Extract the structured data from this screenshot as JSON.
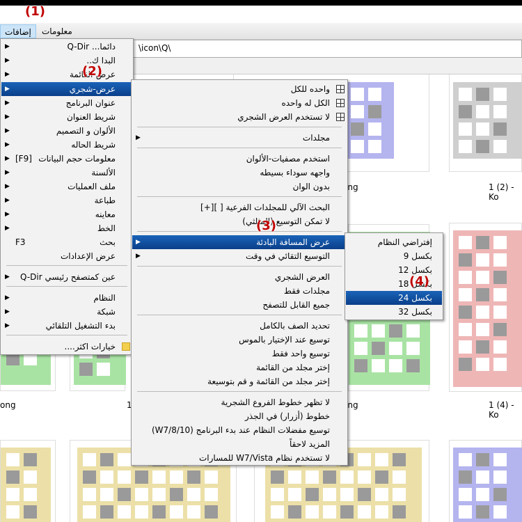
{
  "menubar": {
    "items": [
      "إضافات",
      "معلومات"
    ]
  },
  "address": {
    "path": "\\icon\\Q\\"
  },
  "captions": [
    "ong",
    "1 (2) - Ko",
    "ong",
    "1",
    "ong",
    "1 (4) - Ko"
  ],
  "callouts": [
    "(1)",
    "(2)",
    "(3)",
    "(4)"
  ],
  "menu_extras": {
    "items": [
      {
        "label": "دائما... Q-Dir",
        "sub": true
      },
      {
        "label": "البدا ك..",
        "sub": true
      },
      {
        "label": "عرض-القائمة",
        "sub": true
      },
      {
        "label": "عرض-شجري",
        "sub": true,
        "selected": true
      },
      {
        "label": "عنوان البرنامج",
        "sub": true
      },
      {
        "label": "شريط العنوان",
        "sub": true
      },
      {
        "label": "الألوان و التصميم",
        "sub": true
      },
      {
        "label": "شريط الحاله",
        "sub": true
      },
      {
        "label": "معلومات حجم البيانات",
        "shortcut": "[F9]",
        "sub": true
      },
      {
        "label": "الألسنة",
        "sub": true
      },
      {
        "label": "ملف العمليات",
        "sub": true
      },
      {
        "label": "طباعة",
        "sub": true
      },
      {
        "label": "معاينه",
        "sub": true
      },
      {
        "label": "الخط",
        "sub": true
      },
      {
        "label": "بحث",
        "shortcut": "F3"
      },
      {
        "label": "عرض الإعدادات"
      },
      {
        "label": "Q-Dir عين كمتصفح رئيسي",
        "sub": true
      },
      {
        "label": "النظام",
        "sub": true
      },
      {
        "label": "شبكة",
        "sub": true
      },
      {
        "label": "بدء التشغيل التلقائي",
        "sub": true
      },
      {
        "label": "خيارات اكثر...."
      }
    ]
  },
  "menu_tree": {
    "items": [
      {
        "label": "واحده للكل"
      },
      {
        "label": "الكل له واحده"
      },
      {
        "label": "لا تستخدم العرض الشجري"
      },
      {
        "label": "مجلدات",
        "sub": true
      },
      {
        "label": "استخدم مصفيات-الألوان"
      },
      {
        "label": "واجهه سوداء بسيطه"
      },
      {
        "label": "بدون الوان"
      },
      {
        "label": "البحث الآلي للمجلدات الفرعية [ ][+]"
      },
      {
        "label": "لا تمكن التوسيع (المثلثي)"
      },
      {
        "label": "عرض المسافة البادئة",
        "sub": true,
        "selected": true
      },
      {
        "label": "التوسيع التقائي في وقت",
        "sub": true
      },
      {
        "label": "العرض الشجري"
      },
      {
        "label": "مجلدات فقط"
      },
      {
        "label": "جميع القابل للتصفح"
      },
      {
        "label": "تحديد الصف بالكامل"
      },
      {
        "label": "توسيع عند الإختيار بالموس"
      },
      {
        "label": "توسيع واحد فقط"
      },
      {
        "label": "إختر مجلد من القائمة"
      },
      {
        "label": "إختر مجلد من القائمة و قم بتوسيعة"
      },
      {
        "label": "لا تظهر خطوط الفروع الشجرية"
      },
      {
        "label": "خطوط (أزرار) في الجذر"
      },
      {
        "label": "توسيع مفضلات النظام عند بدء البرنامج (W7/8/10)"
      },
      {
        "label": "المزيد لاحقاً"
      },
      {
        "label": "لا تستخدم نظام W7/Vista للمسارات"
      }
    ]
  },
  "menu_indent": {
    "items": [
      {
        "label": "إفتراضي النظام"
      },
      {
        "label": "بكسل 9"
      },
      {
        "label": "بكسل 12"
      },
      {
        "label": "بكسل 18"
      },
      {
        "label": "بكسل 24",
        "selected": true
      },
      {
        "label": "بكسل 32"
      }
    ]
  },
  "colors": {
    "selected_bg": "#0a4a9a",
    "callout": "#c00000",
    "thumb_purple": "#b4b4ef",
    "thumb_gray": "#cfcfcf",
    "thumb_green": "#a9e3a4",
    "thumb_red": "#efb6b6",
    "thumb_yellow": "#ece0a8"
  }
}
